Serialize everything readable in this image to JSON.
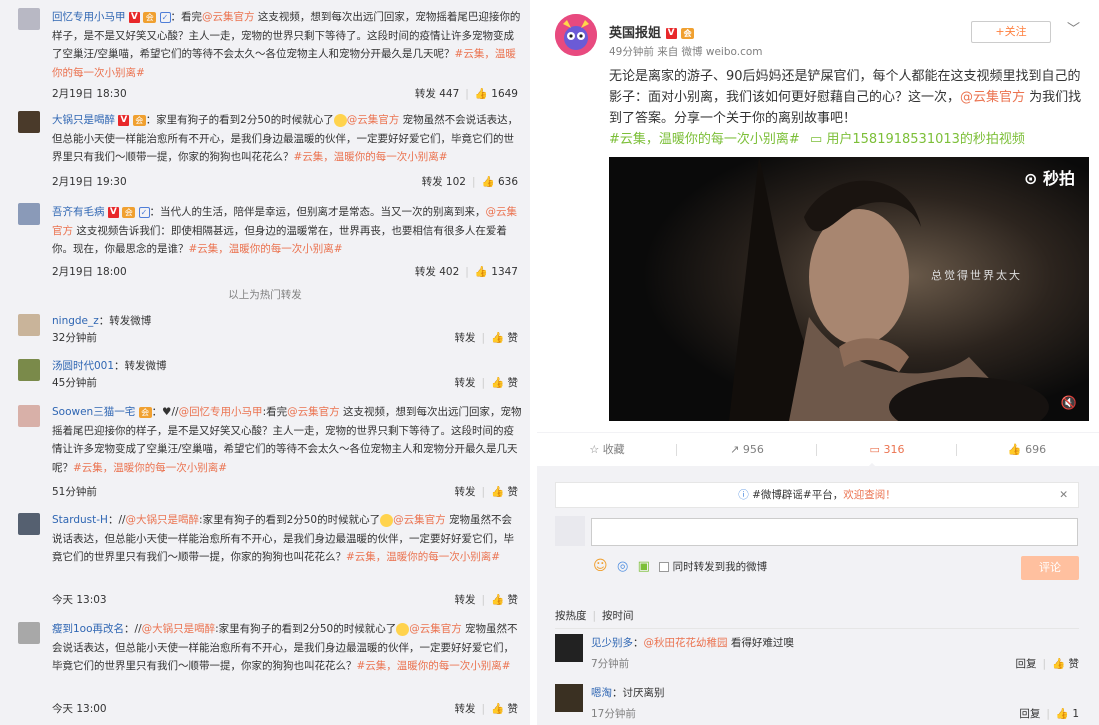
{
  "left": {
    "posts": [
      {
        "name": "回忆专用小马甲",
        "text_before": "：看完",
        "mention": "@云集官方",
        "text_after": " 这支视频，想到每次出远门回家，宠物摇着尾巴迎接你的样子，是不是又好笑又心酸？主人一走，宠物的世界只剩下等待了。这段时间的疫情让许多宠物变成了空巢汪/空巢喵，希望它们的等待不会太久～各位宠物主人和宠物分开最久是几天呢？",
        "topic": "#云集，温暖你的每一次小别离#",
        "time": "2月19日 18:30",
        "repost": "转发 447",
        "like": "1649"
      },
      {
        "name": "大锅只是喝醉",
        "text_before": "：家里有狗子的看到2分50的时候就心了",
        "mention": "@云集官方",
        "text_after": " 宠物虽然不会说话表达，但总能小天使一样能治愈所有不开心，是我们身边最温暖的伙伴，一定要好好爱它们，毕竟它们的世界里只有我们～顺带一提，你家的狗狗也叫花花么？",
        "topic": "#云集，温暖你的每一次小别离#",
        "time": "2月19日 19:30",
        "repost": "转发 102",
        "like": "636"
      },
      {
        "name": "吾齐有毛病",
        "text_before": "：当代人的生活，陪伴是幸运，但别离才是常态。当又一次的别离到来，",
        "mention": "@云集官方",
        "text_after": " 这支视频告诉我们：即使相隔甚远，但身边的温暖常在，世界再丧，也要相信有很多人在爱着你。现在，你最思念的是谁？",
        "topic": "#云集，温暖你的每一次小别离#",
        "time": "2月19日 18:00",
        "repost": "转发 402",
        "like": "1347"
      }
    ],
    "hot_label": "以上为热门转发",
    "reposts": [
      {
        "name": "ningde_z",
        "text": "：转发微博",
        "time": "32分钟前"
      },
      {
        "name": "汤圆时代001",
        "text": "：转发微博",
        "time": "45分钟前"
      },
      {
        "name": "Soowen三猫一宅",
        "text": "：♥//",
        "mention1": "@回忆专用小马甲",
        "text2": ":看完",
        "mention2": "@云集官方",
        "text3": " 这支视频，想到每次出远门回家，宠物摇着尾巴迎接你的样子，是不是又好笑又心酸？主人一走，宠物的世界只剩下等待了。这段时间的疫情让许多宠物变成了空巢汪/空巢喵，希望它们的等待不会太久～各位宠物主人和宠物分开最久是几天呢？",
        "topic": "#云集，温暖你的每一次小别离#",
        "time": "51分钟前"
      },
      {
        "name": "Stardust-H",
        "text": "：//",
        "mention1": "@大锅只是喝醉",
        "text2": ":家里有狗子的看到2分50的时候就心了",
        "mention2": "@云集官方",
        "text3": " 宠物虽然不会说话表达，但总能小天使一样能治愈所有不开心，是我们身边最温暖的伙伴，一定要好好爱它们，毕竟它们的世界里只有我们～顺带一提，你家的狗狗也叫花花么？",
        "topic": "#云集，温暖你的每一次小别离#",
        "time": "今天 13:03"
      },
      {
        "name": "瘦到1oo再改名",
        "text": "：//",
        "mention1": "@大锅只是喝醉",
        "text2": ":家里有狗子的看到2分50的时候就心了",
        "mention2": "@云集官方",
        "text3": " 宠物虽然不会说话表达，但总能小天使一样能治愈所有不开心，是我们身边最温暖的伙伴，一定要好好爱它们，毕竟它们的世界里只有我们～顺带一提，你家的狗狗也叫花花么？",
        "topic": "#云集，温暖你的每一次小别离#",
        "time": "今天 13:00"
      }
    ],
    "repost_label": "转发",
    "like_label": "赞"
  },
  "right": {
    "user_name": "英国报姐",
    "post_meta": "49分钟前 来自 微博 weibo.com",
    "follow_label": "+关注",
    "text_before": "无论是离家的游子、90后妈妈还是铲屎官们，每个人都能在这支视频里找到自己的影子：面对小别离，我们该如何更好慰藉自己的心？这一次，",
    "mention": "@云集官方",
    "text_after": " 为我们找到了答案。分享一个关于你的离别故事吧！",
    "topic": "#云集，温暖你的每一次小别离#",
    "video_link": "用户1581918531013的秒拍视频",
    "video_logo": "秒拍",
    "video_caption": "总觉得世界太大",
    "actions": {
      "favorite": "收藏",
      "repost": "956",
      "comment": "316",
      "like": "696"
    },
    "notice_text": "#微博辟谣#平台，欢迎查阅！",
    "notice_prefix": "#微博辟谣#平台，",
    "notice_link": "欢迎查阅！",
    "also_repost": "同时转发到我的微博",
    "submit_label": "评论",
    "sort_hot": "按热度",
    "sort_time": "按时间",
    "comments": [
      {
        "name": "见少别多",
        "text_before": "：",
        "mention": "@秋田花花幼稚园",
        "text_after": " 看得好难过噢",
        "time": "7分钟前",
        "reply": "回复",
        "like": "赞"
      },
      {
        "name": "嗯淘",
        "text_before": "：讨厌离别",
        "mention": "",
        "text_after": "",
        "time": "17分钟前",
        "reply": "回复",
        "like": "1"
      }
    ]
  },
  "colors": {
    "accent_orange": "#eb7350",
    "link_blue": "#2f66b3",
    "topic_green": "#7cbf38",
    "background_grey": "#f2f2f5"
  }
}
